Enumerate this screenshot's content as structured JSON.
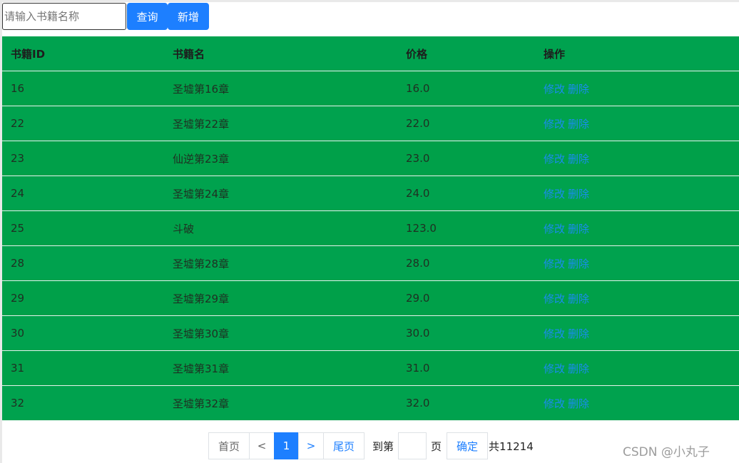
{
  "toolbar": {
    "search_placeholder": "请输入书籍名称",
    "search_value": "",
    "query_label": "查询",
    "add_label": "新增"
  },
  "table": {
    "headers": [
      "书籍ID",
      "书籍名",
      "价格",
      "操作"
    ],
    "rows": [
      {
        "id": "16",
        "name": "圣墟第16章",
        "price": "16.0"
      },
      {
        "id": "22",
        "name": "圣墟第22章",
        "price": "22.0"
      },
      {
        "id": "23",
        "name": "仙逆第23章",
        "price": "23.0"
      },
      {
        "id": "24",
        "name": "圣墟第24章",
        "price": "24.0"
      },
      {
        "id": "25",
        "name": "斗破",
        "price": "123.0"
      },
      {
        "id": "28",
        "name": "圣墟第28章",
        "price": "28.0"
      },
      {
        "id": "29",
        "name": "圣墟第29章",
        "price": "29.0"
      },
      {
        "id": "30",
        "name": "圣墟第30章",
        "price": "30.0"
      },
      {
        "id": "31",
        "name": "圣墟第31章",
        "price": "31.0"
      },
      {
        "id": "32",
        "name": "圣墟第32章",
        "price": "32.0"
      }
    ],
    "edit_label": "修改",
    "delete_label": "删除"
  },
  "pagination": {
    "first": "首页",
    "prev": "<",
    "current": "1",
    "next": ">",
    "last": "尾页",
    "goto_label": "到第",
    "page_unit": "页",
    "confirm": "确定",
    "total": "共11214"
  },
  "watermark": "CSDN @小丸子 ",
  "colors": {
    "table_green": "#00a24e",
    "accent_blue": "#1d7fff",
    "link_blue": "#1a8cf0"
  }
}
